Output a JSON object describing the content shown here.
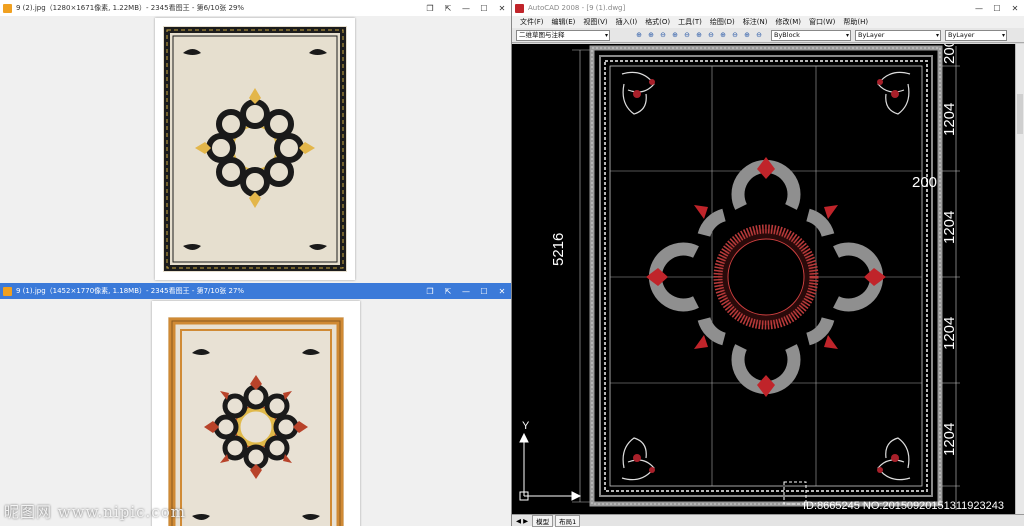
{
  "viewer_top": {
    "title": "9 (2).jpg（1280×1671像素, 1.22MB）- 2345看图王 - 第6/10张 29%"
  },
  "viewer_bottom": {
    "title": "9 (1).jpg（1452×1770像素, 1.18MB）- 2345看图王 - 第7/10张 27%"
  },
  "cad": {
    "title": "AutoCAD 2008 - [9 (1).dwg]",
    "menu": [
      "文件(F)",
      "编辑(E)",
      "视图(V)",
      "插入(I)",
      "格式(O)",
      "工具(T)",
      "绘图(D)",
      "标注(N)",
      "修改(M)",
      "窗口(W)",
      "帮助(H)"
    ],
    "workspace": "二维草图与注释",
    "color_combo": "ByBlock",
    "linetype_combo": "ByLayer",
    "lineweight_combo": "ByLayer",
    "dims": {
      "total": "5216",
      "seg": "1204",
      "border": "200"
    },
    "axis_y": "Y",
    "tabs": [
      "模型",
      "布局1"
    ]
  },
  "watermark": "昵图网 www.nipic.com",
  "id_text": "ID:8665245 NO:20150920151311923243",
  "colors": {
    "title_blue": "#3b7ad9",
    "carpet_beige": "#e8e0d0",
    "cad_red": "#c0242a"
  }
}
